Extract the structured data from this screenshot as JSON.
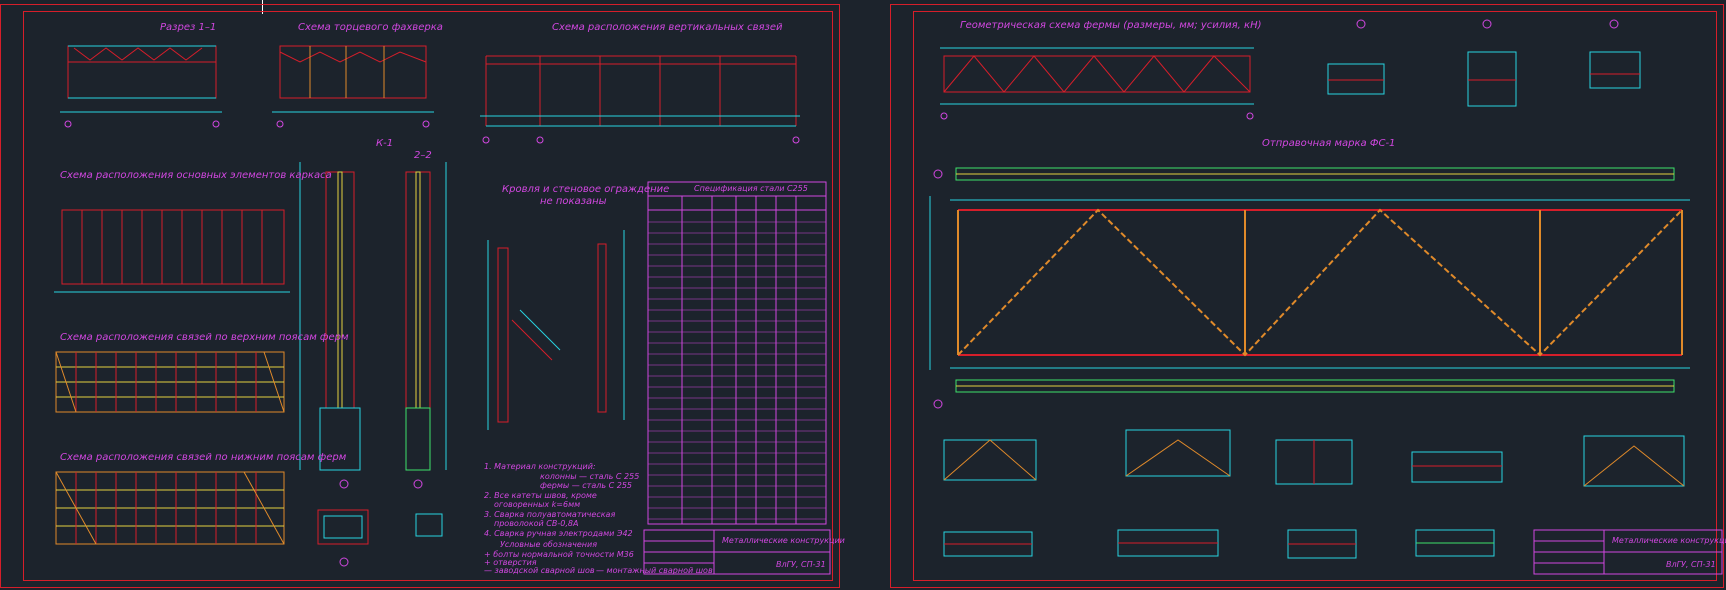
{
  "left_sheet": {
    "titles": {
      "section": "Разрез 1–1",
      "end_frame": "Схема торцевого фахверка",
      "vertical_bracing": "Схема расположения вертикальных связей",
      "main_elements": "Схема расположения основных элементов каркаса",
      "upper_chord": "Схема расположения связей по верхним поясам ферм",
      "lower_chord": "Схема расположения связей по нижним поясам ферм",
      "column": "К-1",
      "section_22": "2–2",
      "roof_note_1": "Кровля и стеновое ограждение",
      "roof_note_2": "не показаны",
      "spec_title": "Спецификация стали С255"
    },
    "notes": [
      "1. Материал конструкций:",
      "колонны — сталь С 255",
      "фермы — сталь С 255",
      "2. Все катеты швов, кроме",
      "оговоренных k=6мм",
      "3. Сварка полуавтоматическая",
      "проволокой СВ-0,8А",
      "4. Сварка ручная электродами Э42"
    ],
    "legend_title": "Условные обозначения",
    "legend": [
      "+ болты нормальной точности М36",
      "+ отверстия",
      "— заводской сварной шов",
      "— монтажный сварной шов"
    ],
    "stamp": {
      "title": "Металлические конструкции",
      "code": "ВлГУ, СП-31"
    }
  },
  "right_sheet": {
    "titles": {
      "geometry": "Геометрическая схема фермы (размеры, мм; усилия, кН)",
      "shipping_mark": "Отправочная марка ФС-1"
    },
    "stamp": {
      "title": "Металлические конструкции",
      "code": "ВлГУ, СП-31"
    }
  },
  "colors": {
    "background": "#1c232c",
    "frame_red": "#d61e2a",
    "cyan": "#27d3e0",
    "magenta": "#d147e0",
    "yellow": "#e3d040",
    "green": "#3ee06a",
    "orange": "#e08a2a"
  }
}
